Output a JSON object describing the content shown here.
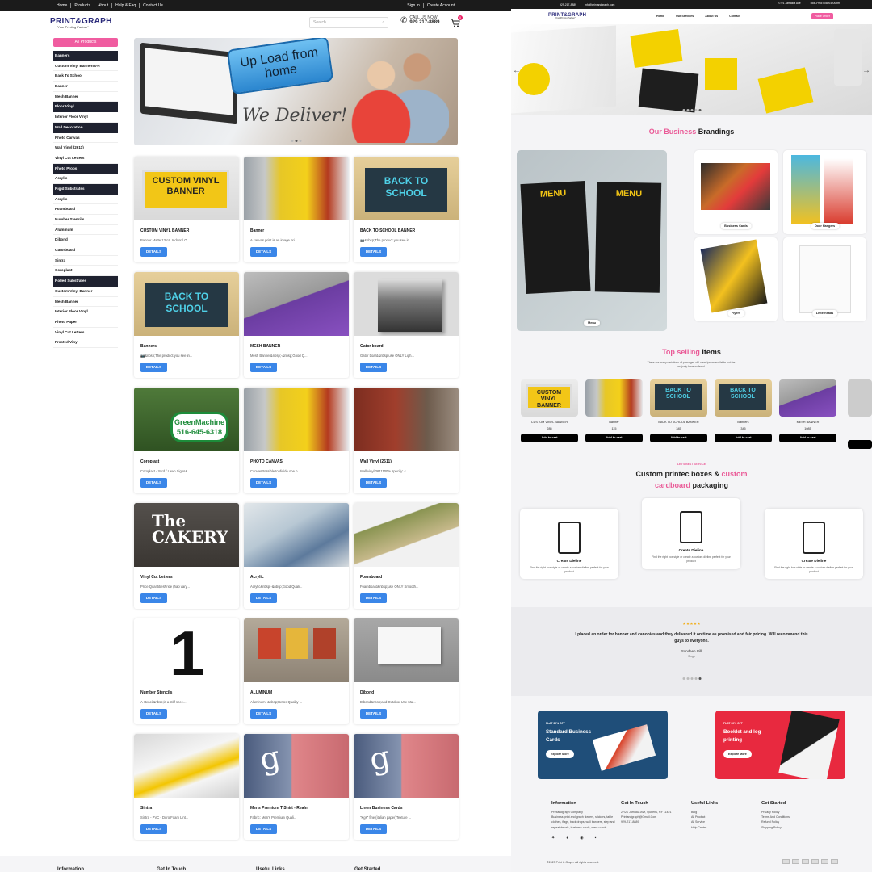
{
  "left": {
    "topbar": {
      "links": [
        "Home",
        "Products",
        "About",
        "Help & Faq",
        "Contact Us"
      ],
      "signin": "Sign In",
      "create_account": "Create Account"
    },
    "header": {
      "logo_text": "PRINT&GRAPH",
      "logo_sub": "\"Your Printing Partner\"",
      "search_placeholder": "Search",
      "call_label": "CALL US NOW",
      "phone": "929 217-8889",
      "cart_count": "0"
    },
    "sidebar": {
      "all_products": "All Products",
      "items": [
        {
          "label": "Banners",
          "cat": true
        },
        {
          "label": "Custom Vinyl Banner50%",
          "cat": false
        },
        {
          "label": "Back To School",
          "cat": false
        },
        {
          "label": "Banner",
          "cat": false
        },
        {
          "label": "Mesh Banner",
          "cat": false
        },
        {
          "label": "Floor Vinyl",
          "cat": true
        },
        {
          "label": "Interior Floor Vinyl",
          "cat": false
        },
        {
          "label": "Wall Decoration",
          "cat": true
        },
        {
          "label": "Photo Canvas",
          "cat": false
        },
        {
          "label": "Wall Vinyl (2611)",
          "cat": false
        },
        {
          "label": "Vinyl Cut Letters",
          "cat": false
        },
        {
          "label": "Photo Props",
          "cat": true
        },
        {
          "label": "Acrylic",
          "cat": false
        },
        {
          "label": "Rigid Substrates",
          "cat": true
        },
        {
          "label": "Acrylic",
          "cat": false
        },
        {
          "label": "Foamboard",
          "cat": false
        },
        {
          "label": "Number Stencils",
          "cat": false
        },
        {
          "label": "Aluminum",
          "cat": false
        },
        {
          "label": "Dibond",
          "cat": false
        },
        {
          "label": "Gatorboard",
          "cat": false
        },
        {
          "label": "Sintra",
          "cat": false
        },
        {
          "label": "Coroplast",
          "cat": false
        },
        {
          "label": "Rolled Substrates",
          "cat": true
        },
        {
          "label": "Custom Vinyl Banner",
          "cat": false
        },
        {
          "label": "Mesh Banner",
          "cat": false
        },
        {
          "label": "Interior Floor Vinyl",
          "cat": false
        },
        {
          "label": "Photo Paper",
          "cat": false
        },
        {
          "label": "Vinyl Cut Letters",
          "cat": false
        },
        {
          "label": "Frosted Vinyl",
          "cat": false
        }
      ]
    },
    "banner": {
      "key_text": "Up Load from home",
      "tagline": "We Deliver!"
    },
    "products": [
      {
        "title": "CUSTOM VINYL BANNER",
        "desc": "Banner Matte 13 oz. Indoor / O...",
        "img": "cvb",
        "img_text": "CUSTOM VINYL BANNER"
      },
      {
        "title": "Banner",
        "desc": "A canvas print is an image pri...",
        "img": "canvas",
        "img_text": ""
      },
      {
        "title": "BACK TO SCHOOL BANNER",
        "desc": "📷&nbsp;The product you see in...",
        "img": "bts",
        "img_text": "BACK TO SCHOOL"
      },
      {
        "title": "Banners",
        "desc": "📷&nbsp;The product you see in...",
        "img": "bts",
        "img_text": "BACK TO SCHOOL"
      },
      {
        "title": "MESH BANNER",
        "desc": "Mesh Banner&nbsp;-&nbsp;Good Q...",
        "img": "mesh",
        "img_text": ""
      },
      {
        "title": "Gator board",
        "desc": "Gator board&nbsp;use ONLY Ligh...",
        "img": "gator",
        "img_text": ""
      },
      {
        "title": "Coroplast",
        "desc": "Coroplast - Yard / Lawn Signs&...",
        "img": "coro",
        "img_text": "GreenMachine 516-645-6318"
      },
      {
        "title": "PHOTO CANVAS",
        "desc": "CanvasPossible to divide one p...",
        "img": "canvas",
        "img_text": ""
      },
      {
        "title": "Wall Vinyl (2611)",
        "desc": "Wall vinyl 2611100% specify: c...",
        "img": "wall",
        "img_text": ""
      },
      {
        "title": "Vinyl Cut Letters",
        "desc": "Price QuantitiesPrice (hap vary...",
        "img": "vcl",
        "img_text": "The CAKERY"
      },
      {
        "title": "Acrylic",
        "desc": "Acrylic&nbsp;-&nbsp;Good Quali...",
        "img": "acr",
        "img_text": ""
      },
      {
        "title": "Foamboard",
        "desc": "Foamboard&nbsp;use ONLY Smooth...",
        "img": "foam",
        "img_text": ""
      },
      {
        "title": "Number Stencils",
        "desc": "A stencil&nbsp;is a stiff shee...",
        "img": "num",
        "img_text": "1"
      },
      {
        "title": "ALUMINUM",
        "desc": "Aluminum -&nbsp;Better Quality ...",
        "img": "alu",
        "img_text": ""
      },
      {
        "title": "Dibond",
        "desc": "Dibond&nbsp;and Outdoor Use Ma...",
        "img": "dib",
        "img_text": ""
      },
      {
        "title": "Sintra",
        "desc": "Sintra - PVC - Duro Foam Lint...",
        "img": "sin",
        "img_text": ""
      },
      {
        "title": "Mens Premium T-Shirt - Realm",
        "desc": "Fabric: Men's Premium Quali...",
        "img": "tee",
        "img_text": "g"
      },
      {
        "title": "Linen Business Cards",
        "desc": "\"Kgs\" fine (italian paper)Texture ...",
        "img": "tee",
        "img_text": "g"
      }
    ],
    "details_label": "DETAILS",
    "footer": {
      "cols": [
        "Information",
        "Get In Touch",
        "Useful Links",
        "Get Started"
      ]
    }
  },
  "right": {
    "topbar": {
      "phone": "929-217-8889",
      "email": "info@printandgraph.com",
      "address": "27/21 Jamaica Ave",
      "hours": "Mon-Fri 8:00am-6:00pm"
    },
    "header": {
      "logo_text": "PRINT&GRAPH",
      "logo_sub": "\"Your Printing Partner\"",
      "nav": [
        "Home",
        "Our Services",
        "About Us",
        "Contact"
      ],
      "order": "Place Order"
    },
    "brandings": {
      "title_pink": "Our Business",
      "title_dark": "Brandings",
      "items": [
        "Menu",
        "Business Cards",
        "Door Hangers",
        "Flyers",
        "Letterheads"
      ],
      "menu_text": "MENU"
    },
    "top_selling": {
      "title_pink": "Top selling",
      "title_dark": "items",
      "sub": "There are many variations of passages of Lorem Ipsum available but the majority have suffered",
      "items": [
        {
          "name": "CUSTOM VINYL BANNER",
          "price": "285",
          "img": "cvb"
        },
        {
          "name": "Banner",
          "price": "115",
          "img": "canvas"
        },
        {
          "name": "BACK TO SCHOOL BANNER",
          "price": "345",
          "img": "bts"
        },
        {
          "name": "Banners",
          "price": "345",
          "img": "bts"
        },
        {
          "name": "MESH BANNER",
          "price": "1085",
          "img": "mesh"
        }
      ],
      "add_label": "Add to cart"
    },
    "packaging": {
      "eyebrow": "LET'S BEST SERVICE",
      "title_a": "Custom printec boxes &",
      "title_b": "custom",
      "title_c": "cardboard",
      "title_d": "packaging",
      "cards": [
        {
          "title": "Create Dieline",
          "desc": "Find the right box style or create a custom dieline perfect for your product"
        },
        {
          "title": "Create Dieline",
          "desc": "Find the right box style or create a custom dieline perfect for your product"
        },
        {
          "title": "Create Dieline",
          "desc": "Find the right box style or create a custom dieline perfect for your product"
        }
      ]
    },
    "testimonial": {
      "stars": "★★★★★",
      "quote": "I placed an order for banner and canopies and they delivered it on time as promised and fair pricing. Will recommend this guys to everyone.",
      "author": "Sandeep Gill",
      "role": "Singh"
    },
    "promos": [
      {
        "tag": "FLAT 30% OFF",
        "title": "Standard Business Cards",
        "button": "Explore More",
        "color": "#1f4e79"
      },
      {
        "tag": "FLAT 30% OFF",
        "title": "Booklet and log printing",
        "button": "Explore More",
        "color": "#e8293f"
      }
    ],
    "footer": {
      "cols": [
        {
          "title": "Information",
          "lines": [
            "Printandgraph Company",
            "Business print and graph flowers, stickers, table clothes, flags, back drops, wall banners, step and repeat decals, business cards, menu cards"
          ]
        },
        {
          "title": "Get In Touch",
          "lines": [
            "27/21 Jamaica Ave, Queens, NY 11421",
            "Printandgraph@Gmail.Com",
            "929-217-8889"
          ]
        },
        {
          "title": "Useful Links",
          "lines": [
            "Blog",
            "All Product",
            "All Service",
            "Help Center"
          ]
        },
        {
          "title": "Get Started",
          "lines": [
            "Privacy Policy",
            "Terms And Conditions",
            "Refund Policy",
            "Shipping Policy"
          ]
        }
      ],
      "copyright": "©2023 Print & Graph. All rights reserved."
    }
  }
}
